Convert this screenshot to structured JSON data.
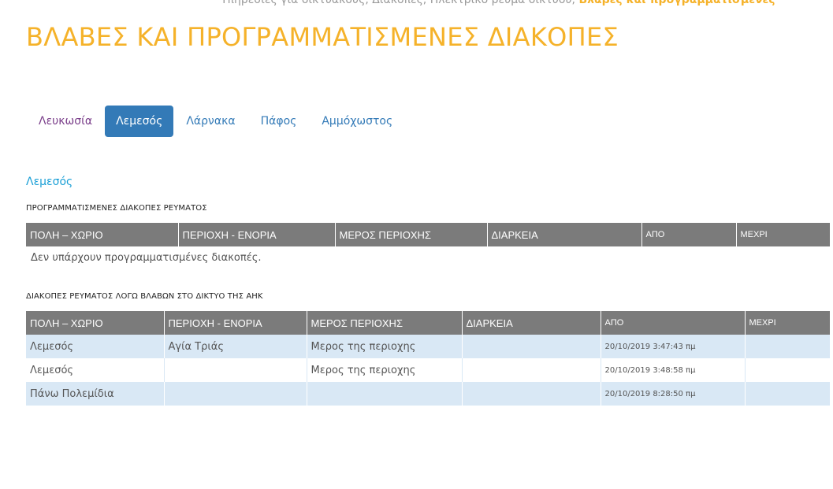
{
  "breadcrumb": {
    "items": [
      "Υπηρεσίες για δικτυακούς",
      "Διακοπές",
      "Ηλεκτρικό ρεύμα δικτύου"
    ],
    "current": "Βλάβες και προγραμματισμένες"
  },
  "page_title": "ΒΛΑΒΕΣ ΚΑΙ ΠΡΟΓΡΑΜΜΑΤΙΣΜΕΝΕΣ ΔΙΑΚΟΠΕΣ",
  "tabs": [
    {
      "label": "Λευκωσία",
      "state": "visited"
    },
    {
      "label": "Λεμεσός",
      "state": "active"
    },
    {
      "label": "Λάρνακα",
      "state": "normal"
    },
    {
      "label": "Πάφος",
      "state": "normal"
    },
    {
      "label": "Αμμόχωστος",
      "state": "normal"
    }
  ],
  "city_title": "Λεμεσός",
  "scheduled": {
    "label": "ΠΡΟΓΡΑΜΜΑΤΙΣΜΕΝΕΣ ΔΙΑΚΟΠΕΣ ΡΕΥΜΑΤΟΣ",
    "headers": [
      "ΠΟΛΗ – ΧΩΡΙΟ",
      "ΠΕΡΙΟΧΗ - ΕΝΟΡΙΑ",
      "ΜΕΡΟΣ ΠΕΡΙΟΧΗΣ",
      "ΔΙΑΡΚΕΙΑ",
      "ΑΠΟ",
      "ΜΕΧΡΙ"
    ],
    "empty_message": "Δεν υπάρχουν προγραμματισμένες διακοπές."
  },
  "faults": {
    "label": "ΔΙΑΚΟΠΕΣ ΡΕΥΜΑΤΟΣ ΛΟΓΩ ΒΛΑΒΩΝ ΣΤΟ ΔΙΚΤΥΟ ΤΗΣ ΑΗΚ",
    "headers": [
      "ΠΟΛΗ – ΧΩΡΙΟ",
      "ΠΕΡΙΟΧΗ - ΕΝΟΡΙΑ",
      "ΜΕΡΟΣ ΠΕΡΙΟΧΗΣ",
      "ΔΙΑΡΚΕΙΑ",
      "ΑΠΟ",
      "ΜΕΧΡΙ"
    ],
    "rows": [
      [
        "Λεμεσός",
        "Αγία Τριάς",
        "Μερος της περιοχης",
        "",
        "20/10/2019 3:47:43 πμ",
        ""
      ],
      [
        "Λεμεσός",
        "",
        "Μερος της περιοχης",
        "",
        "20/10/2019 3:48:58 πμ",
        ""
      ],
      [
        "Πάνω Πολεμίδια",
        "",
        "",
        "",
        "20/10/2019 8:28:50 πμ",
        ""
      ]
    ]
  },
  "colors": {
    "title": "#f5b22a",
    "tab_active_bg": "#337ab7",
    "link": "#337ab7",
    "table_header_bg": "#7b7b7b",
    "row_stripe": "#d9e8f5"
  }
}
